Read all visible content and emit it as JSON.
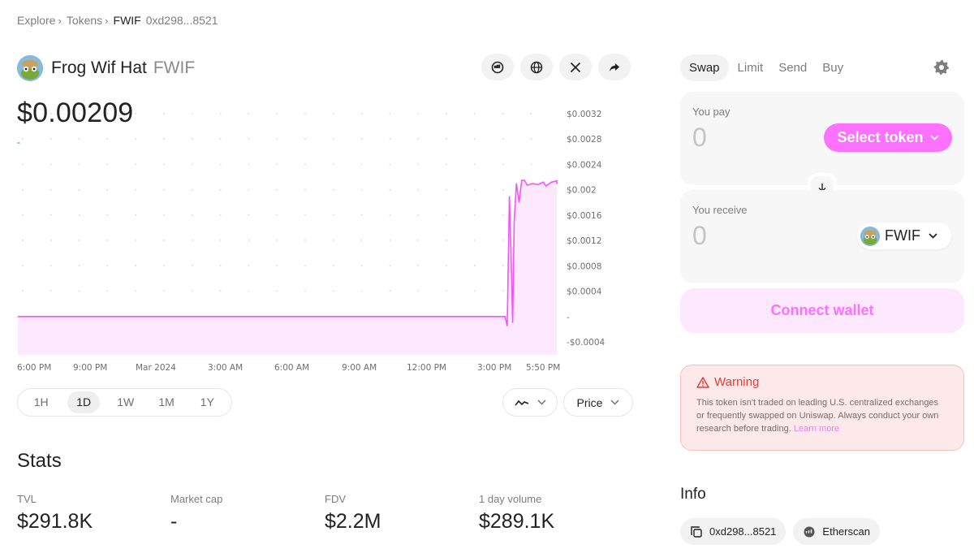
{
  "breadcrumb": {
    "explore": "Explore",
    "tokens": "Tokens",
    "symbol": "FWIF",
    "address": "0xd298...8521",
    "sep": "›"
  },
  "token": {
    "name": "Frog Wif Hat",
    "symbol": "FWIF",
    "price": "$0.00209",
    "delta": "-"
  },
  "header_actions": [
    "etherscan-icon",
    "globe-icon",
    "x-twitter-icon",
    "share-icon"
  ],
  "chart_data": {
    "type": "area",
    "x_ticks": [
      "6:00 PM",
      "9:00 PM",
      "Mar 2024",
      "3:00 AM",
      "6:00 AM",
      "9:00 AM",
      "12:00 PM",
      "3:00 PM",
      "5:50 PM"
    ],
    "y_ticks": [
      "$0.0032",
      "$0.0028",
      "$0.0024",
      "$0.002",
      "$0.0016",
      "$0.0012",
      "$0.0008",
      "$0.0004",
      "-",
      "-$0.0004"
    ],
    "ylim": [
      -0.0004,
      0.0032
    ],
    "series": [
      {
        "points": [
          [
            0,
            0
          ],
          [
            0.904,
            0
          ],
          [
            0.908,
            -0.00015
          ],
          [
            0.912,
            0.0019
          ],
          [
            0.916,
            0.0007
          ],
          [
            0.918,
            -0.0001
          ],
          [
            0.921,
            0.0015
          ],
          [
            0.925,
            0.0021
          ],
          [
            0.93,
            0.0018
          ],
          [
            0.935,
            0.00215
          ],
          [
            0.94,
            0.00215
          ],
          [
            0.945,
            0.00207
          ],
          [
            0.955,
            0.0021
          ],
          [
            0.965,
            0.00208
          ],
          [
            0.975,
            0.00212
          ],
          [
            0.98,
            0.00206
          ],
          [
            0.99,
            0.00212
          ],
          [
            1.0,
            0.00214
          ],
          [
            1.005,
            0.00209
          ]
        ]
      }
    ],
    "colors": {
      "line": "#f256f5",
      "fill": "#fde8fe"
    }
  },
  "timeframes": [
    "1H",
    "1D",
    "1W",
    "1M",
    "1Y"
  ],
  "active_timeframe": "1D",
  "chart_controls": {
    "type_icon": "line-chart-icon",
    "price_label": "Price"
  },
  "stats": {
    "title": "Stats",
    "items": [
      {
        "label": "TVL",
        "value": "$291.8K"
      },
      {
        "label": "Market cap",
        "value": "-"
      },
      {
        "label": "FDV",
        "value": "$2.2M"
      },
      {
        "label": "1 day volume",
        "value": "$289.1K"
      }
    ]
  },
  "swap": {
    "tabs": [
      "Swap",
      "Limit",
      "Send",
      "Buy"
    ],
    "pay_label": "You pay",
    "pay_amount": "0",
    "select_token": "Select token",
    "receive_label": "You receive",
    "receive_amount": "0",
    "receive_token": "FWIF",
    "connect": "Connect wallet"
  },
  "warning": {
    "title": "Warning",
    "text": "This token isn't traded on leading U.S. centralized exchanges or frequently swapped on Uniswap. Always conduct your own research before trading. ",
    "link": "Learn more"
  },
  "info": {
    "title": "Info",
    "address": "0xd298...8521",
    "etherscan": "Etherscan"
  },
  "colors": {
    "accent": "#fc72ff",
    "warning": "#e83b3b"
  }
}
